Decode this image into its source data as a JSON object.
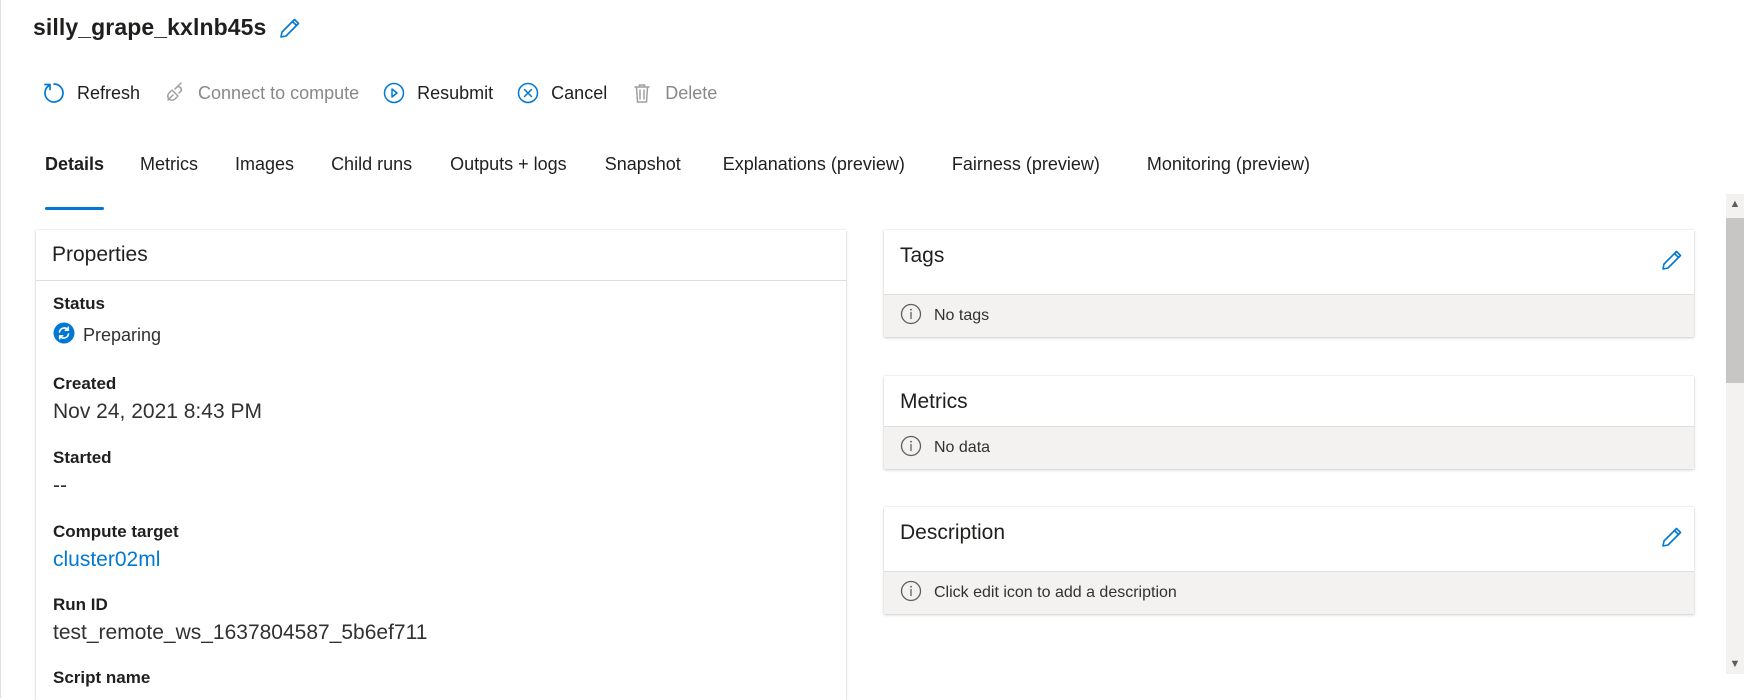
{
  "header": {
    "title": "silly_grape_kxlnb45s"
  },
  "toolbar": {
    "refresh": "Refresh",
    "connect": "Connect to compute",
    "resubmit": "Resubmit",
    "cancel": "Cancel",
    "delete": "Delete"
  },
  "tabs": [
    {
      "label": "Details",
      "active": true
    },
    {
      "label": "Metrics"
    },
    {
      "label": "Images"
    },
    {
      "label": "Child runs"
    },
    {
      "label": "Outputs + logs"
    },
    {
      "label": "Snapshot"
    },
    {
      "label": "Explanations (preview)"
    },
    {
      "label": "Fairness (preview)"
    },
    {
      "label": "Monitoring (preview)"
    }
  ],
  "properties": {
    "title": "Properties",
    "status_label": "Status",
    "status_value": "Preparing",
    "created_label": "Created",
    "created_value": "Nov 24, 2021 8:43 PM",
    "started_label": "Started",
    "started_value": "--",
    "compute_label": "Compute target",
    "compute_value": "cluster02ml",
    "runid_label": "Run ID",
    "runid_value": "test_remote_ws_1637804587_5b6ef711",
    "script_label": "Script name"
  },
  "tags": {
    "title": "Tags",
    "empty": "No tags"
  },
  "metrics": {
    "title": "Metrics",
    "empty": "No data"
  },
  "description": {
    "title": "Description",
    "empty": "Click edit icon to add a description"
  },
  "colors": {
    "accent": "#0078d4",
    "text": "#323130",
    "muted": "#8a8886",
    "footer_bg": "#f3f2f1"
  }
}
